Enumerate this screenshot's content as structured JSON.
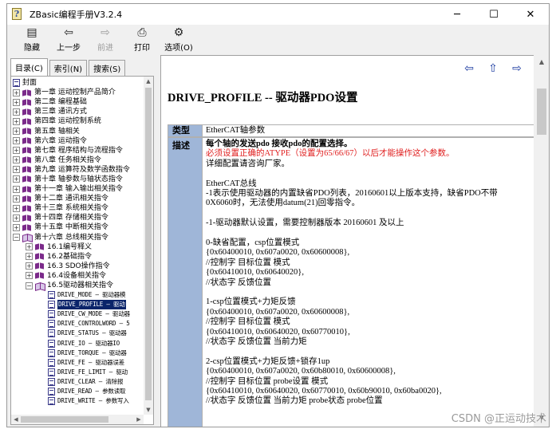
{
  "window": {
    "title": "ZBasic编程手册V3.2.4",
    "app_icon_letter": "?",
    "controls": {
      "minimize": "─",
      "maximize": "☐",
      "close": "✕"
    }
  },
  "toolbar": {
    "buttons": [
      {
        "id": "hide",
        "label": "隐藏",
        "icon": "hide-icon",
        "glyph": "▤",
        "enabled": true
      },
      {
        "id": "back",
        "label": "上一步",
        "icon": "back-arrow-icon",
        "glyph": "⇦",
        "enabled": true
      },
      {
        "id": "forward",
        "label": "前进",
        "icon": "forward-arrow-icon",
        "glyph": "⇨",
        "enabled": false
      },
      {
        "id": "print",
        "label": "打印",
        "icon": "printer-icon",
        "glyph": "⎙",
        "enabled": true
      },
      {
        "id": "options",
        "label": "选项(O)",
        "icon": "options-icon",
        "glyph": "⚙",
        "enabled": true
      }
    ]
  },
  "tabs": [
    {
      "label": "目录(C)",
      "active": true
    },
    {
      "label": "索引(N)",
      "active": false
    },
    {
      "label": "搜索(S)",
      "active": false
    }
  ],
  "tree": [
    {
      "level": 0,
      "kind": "page",
      "text": "封面"
    },
    {
      "level": 0,
      "kind": "book",
      "exp": "+",
      "text": "第一章  运动控制产品简介"
    },
    {
      "level": 0,
      "kind": "book",
      "exp": "+",
      "text": "第二章  编程基础"
    },
    {
      "level": 0,
      "kind": "book",
      "exp": "+",
      "text": "第三章  通讯方式"
    },
    {
      "level": 0,
      "kind": "book",
      "exp": "+",
      "text": "第四章  运动控制系统"
    },
    {
      "level": 0,
      "kind": "book",
      "exp": "+",
      "text": "第五章  轴相关"
    },
    {
      "level": 0,
      "kind": "book",
      "exp": "+",
      "text": "第六章  运动指令"
    },
    {
      "level": 0,
      "kind": "book",
      "exp": "+",
      "text": "第七章  程序结构与流程指令"
    },
    {
      "level": 0,
      "kind": "book",
      "exp": "+",
      "text": "第八章  任务相关指令"
    },
    {
      "level": 0,
      "kind": "book",
      "exp": "+",
      "text": "第九章  运算符及数学函数指令"
    },
    {
      "level": 0,
      "kind": "book",
      "exp": "+",
      "text": "第十章  轴参数与轴状态指令"
    },
    {
      "level": 0,
      "kind": "book",
      "exp": "+",
      "text": "第十一章  输入输出相关指令"
    },
    {
      "level": 0,
      "kind": "book",
      "exp": "+",
      "text": "第十二章  通讯相关指令"
    },
    {
      "level": 0,
      "kind": "book",
      "exp": "+",
      "text": "第十三章  系统相关指令"
    },
    {
      "level": 0,
      "kind": "book",
      "exp": "+",
      "text": "第十四章  存储相关指令"
    },
    {
      "level": 0,
      "kind": "book",
      "exp": "+",
      "text": "第十五章  中断相关指令"
    },
    {
      "level": 0,
      "kind": "book-open",
      "exp": "−",
      "text": "第十六章  总线相关指令"
    },
    {
      "level": 1,
      "kind": "book",
      "exp": "+",
      "text": "16.1编号释义"
    },
    {
      "level": 1,
      "kind": "book",
      "exp": "+",
      "text": "16.2基础指令"
    },
    {
      "level": 1,
      "kind": "book",
      "exp": "+",
      "text": "16.3 SDO操作指令"
    },
    {
      "level": 1,
      "kind": "book",
      "exp": "+",
      "text": "16.4设备相关指令"
    },
    {
      "level": 1,
      "kind": "book-open",
      "exp": "−",
      "text": "16.5驱动器相关指令"
    },
    {
      "level": 2,
      "kind": "page",
      "mono": true,
      "text": "DRIVE_MODE — 驱动器模"
    },
    {
      "level": 2,
      "kind": "page",
      "mono": true,
      "selected": true,
      "text": "DRIVE_PROFILE — 驱动"
    },
    {
      "level": 2,
      "kind": "page",
      "mono": true,
      "text": "DRIVE_CW_MODE — 驱动器"
    },
    {
      "level": 2,
      "kind": "page",
      "mono": true,
      "text": "DRIVE_CONTROLWORD — 5"
    },
    {
      "level": 2,
      "kind": "page",
      "mono": true,
      "text": "DRIVE_STATUS — 驱动器"
    },
    {
      "level": 2,
      "kind": "page",
      "mono": true,
      "text": "DRIVE_IO — 驱动器IO"
    },
    {
      "level": 2,
      "kind": "page",
      "mono": true,
      "text": "DRIVE_TORQUE — 驱动器"
    },
    {
      "level": 2,
      "kind": "page",
      "mono": true,
      "text": "DRIVE_FE — 驱动器误差"
    },
    {
      "level": 2,
      "kind": "page",
      "mono": true,
      "text": "DRIVE_FE_LIMIT — 驱动"
    },
    {
      "level": 2,
      "kind": "page",
      "mono": true,
      "text": "DRIVE_CLEAR — 清除报"
    },
    {
      "level": 2,
      "kind": "page",
      "mono": true,
      "text": "DRIVE_READ — 参数读取"
    },
    {
      "level": 2,
      "kind": "page",
      "mono": true,
      "text": "DRIVE_WRITE — 参数写入"
    }
  ],
  "content": {
    "nav": {
      "prev": "⇦",
      "up": "⇧",
      "next": "⇨"
    },
    "title": "DRIVE_PROFILE -- 驱动器PDO设置",
    "type_label": "类型",
    "type_value": "EtherCAT轴参数",
    "desc_label": "描述",
    "desc_lines": [
      {
        "text": "每个轴的发送pdo 接收pdo的配置选择。",
        "style": "bold"
      },
      {
        "text": "必须设置正确的ATYPE（设置为65/66/67）以后才能操作这个参数。",
        "style": "red"
      },
      {
        "text": "详细配置请咨询厂家。",
        "style": ""
      },
      {
        "text": "",
        "style": "blank"
      },
      {
        "text": "EtherCAT总线",
        "style": ""
      },
      {
        "text": "-1表示使用驱动器的内置缺省PDO列表，20160601以上版本支持，缺省PDO不带",
        "style": ""
      },
      {
        "text": "0X6060时，无法使用datum(21)回零指令。",
        "style": ""
      },
      {
        "text": "",
        "style": "blank"
      },
      {
        "text": "-1-驱动器默认设置，需要控制器版本 20160601 及以上",
        "style": ""
      },
      {
        "text": "",
        "style": "blank"
      },
      {
        "text": "0-缺省配置，csp位置模式",
        "style": ""
      },
      {
        "text": "{0x60400010, 0x607a0020, 0x60600008},",
        "style": ""
      },
      {
        "text": "//控制字       目标位置       模式",
        "style": ""
      },
      {
        "text": "{0x60410010, 0x60640020},",
        "style": ""
      },
      {
        "text": "//状态字       反馈位置",
        "style": ""
      },
      {
        "text": "",
        "style": "blank"
      },
      {
        "text": "1-csp位置模式+力矩反馈",
        "style": ""
      },
      {
        "text": "{0x60400010, 0x607a0020, 0x60600008},",
        "style": ""
      },
      {
        "text": "//控制字         目标位置           模式",
        "style": ""
      },
      {
        "text": "{0x60410010, 0x60640020, 0x60770010},",
        "style": ""
      },
      {
        "text": "//状态字         反馈位置          当前力矩",
        "style": ""
      },
      {
        "text": "",
        "style": "blank"
      },
      {
        "text": "2-csp位置模式+力矩反馈+锁存1up",
        "style": ""
      },
      {
        "text": "{0x60400010, 0x607a0020, 0x60b80010, 0x60600008},",
        "style": ""
      },
      {
        "text": "//控制字       目标位置      probe设置     模式",
        "style": ""
      },
      {
        "text": "{0x60410010, 0x60640020, 0x60770010, 0x60b90010, 0x60ba0020},",
        "style": ""
      },
      {
        "text": "//状态字       反馈位置    当前力矩     probe状态  probe位置",
        "style": ""
      }
    ]
  },
  "watermark": "CSDN @正运动技术",
  "colors": {
    "label_bg": "#9fb6d8",
    "warning": "#e02020",
    "selection": "#0a246a",
    "nav": "#1a3aa0"
  }
}
